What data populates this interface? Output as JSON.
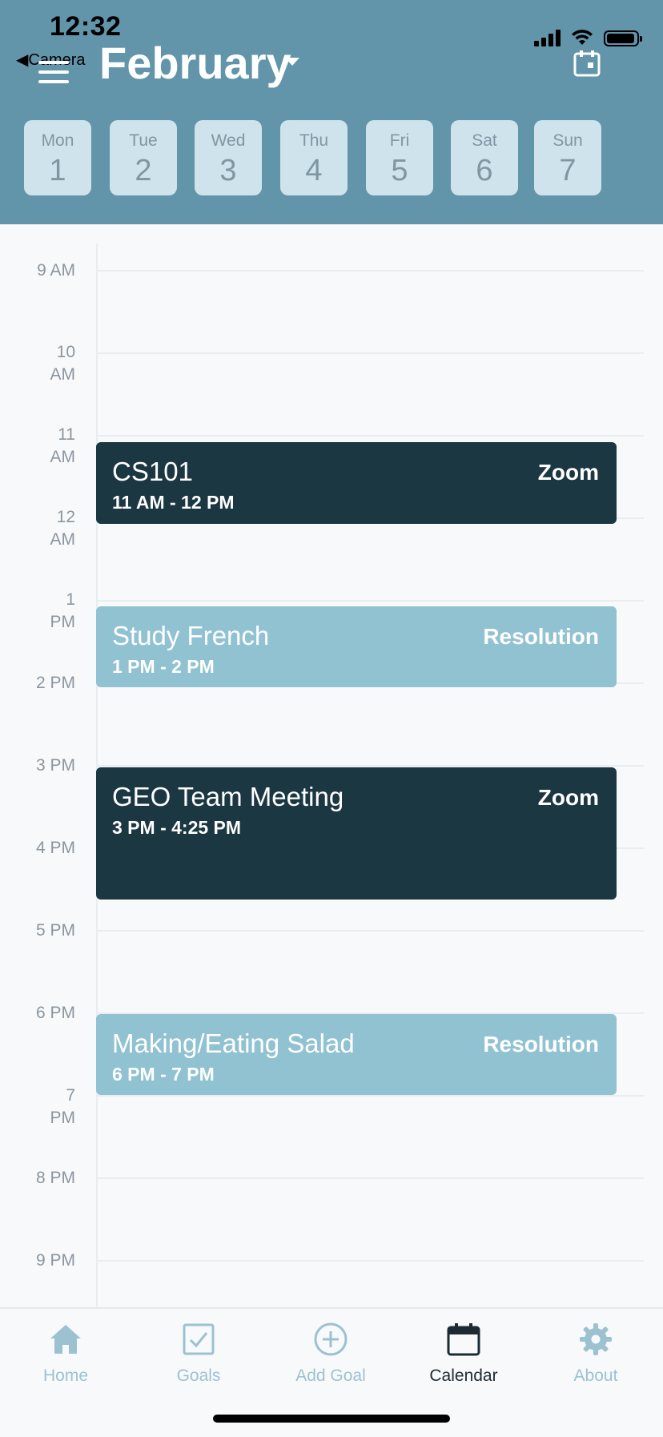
{
  "status_bar": {
    "time": "12:32",
    "back_label": "Camera"
  },
  "header": {
    "month": "February"
  },
  "week": [
    {
      "name": "Mon",
      "date": "1"
    },
    {
      "name": "Tue",
      "date": "2"
    },
    {
      "name": "Wed",
      "date": "3"
    },
    {
      "name": "Thu",
      "date": "4"
    },
    {
      "name": "Fri",
      "date": "5"
    },
    {
      "name": "Sat",
      "date": "6"
    },
    {
      "name": "Sun",
      "date": "7"
    }
  ],
  "hours": [
    {
      "l1": "9 AM",
      "l2": ""
    },
    {
      "l1": "10",
      "l2": "AM"
    },
    {
      "l1": "11",
      "l2": "AM"
    },
    {
      "l1": "12",
      "l2": "AM"
    },
    {
      "l1": "1",
      "l2": "PM"
    },
    {
      "l1": "2 PM",
      "l2": ""
    },
    {
      "l1": "3 PM",
      "l2": ""
    },
    {
      "l1": "4 PM",
      "l2": ""
    },
    {
      "l1": "5 PM",
      "l2": ""
    },
    {
      "l1": "6 PM",
      "l2": ""
    },
    {
      "l1": "7",
      "l2": "PM"
    },
    {
      "l1": "8 PM",
      "l2": ""
    },
    {
      "l1": "9 PM",
      "l2": ""
    }
  ],
  "events": [
    {
      "title": "CS101",
      "time": "11 AM - 12 PM",
      "tag": "Zoom",
      "style": "dark"
    },
    {
      "title": "Study French",
      "time": "1 PM - 2 PM",
      "tag": "Resolution",
      "style": "light"
    },
    {
      "title": "GEO Team Meeting",
      "time": "3 PM - 4:25 PM",
      "tag": "Zoom",
      "style": "dark"
    },
    {
      "title": "Making/Eating Salad",
      "time": "6 PM - 7 PM",
      "tag": "Resolution",
      "style": "light"
    }
  ],
  "tabs": {
    "home": "Home",
    "goals": "Goals",
    "add_goal": "Add Goal",
    "calendar": "Calendar",
    "about": "About"
  },
  "colors": {
    "header_bg": "#6294aa",
    "event_dark": "#1b3742",
    "event_light": "#91c2d2",
    "tab_inactive": "#9cc2d2",
    "tab_active": "#1c2b33"
  }
}
